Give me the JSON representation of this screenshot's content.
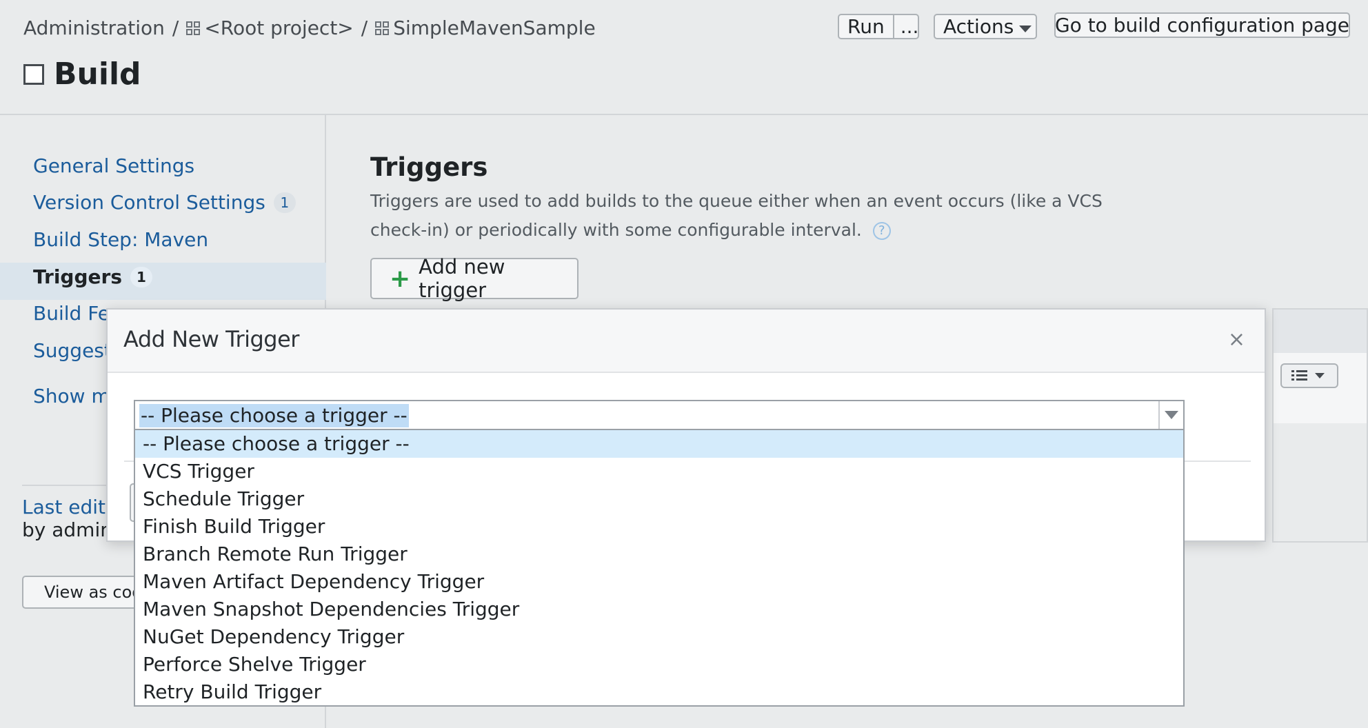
{
  "breadcrumb": {
    "items": [
      "Administration",
      "<Root project>",
      "SimpleMavenSample"
    ],
    "separator": "/"
  },
  "page": {
    "title": "Build"
  },
  "top_actions": {
    "run_label": "Run",
    "more_label": "...",
    "actions_label": "Actions",
    "goto_label": "Go to build configuration page"
  },
  "sidebar": {
    "items": [
      {
        "label": "General Settings",
        "badge": ""
      },
      {
        "label": "Version Control Settings",
        "badge": "1"
      },
      {
        "label": "Build Step: Maven",
        "badge": ""
      },
      {
        "label": "Triggers",
        "badge": "1"
      },
      {
        "label": "Build Fe",
        "badge": ""
      },
      {
        "label": "Suggest",
        "badge": ""
      }
    ],
    "show_more": "Show m",
    "last_edited": "Last edite",
    "by_admin": "by admin",
    "view_as_code": "View as cod"
  },
  "main": {
    "title": "Triggers",
    "description": "Triggers are used to add builds to the queue either when an event occurs (like a VCS check-in) or periodically with some configurable interval.",
    "help_icon": "?",
    "add_button": "Add new trigger",
    "add_icon": "+"
  },
  "dialog": {
    "title": "Add New Trigger",
    "close_icon": "×",
    "select_value": "-- Please choose a trigger --",
    "options": [
      "-- Please choose a trigger --",
      "VCS Trigger",
      "Schedule Trigger",
      "Finish Build Trigger",
      "Branch Remote Run Trigger",
      "Maven Artifact Dependency Trigger",
      "Maven Snapshot Dependencies Trigger",
      "NuGet Dependency Trigger",
      "Perforce Shelve Trigger",
      "Retry Build Trigger"
    ],
    "selected_index": 0
  },
  "colors": {
    "link": "#1b5c9b",
    "accent_green": "#2b9a48",
    "selection": "#d4ebfb",
    "header_bg": "#e9ebec"
  }
}
